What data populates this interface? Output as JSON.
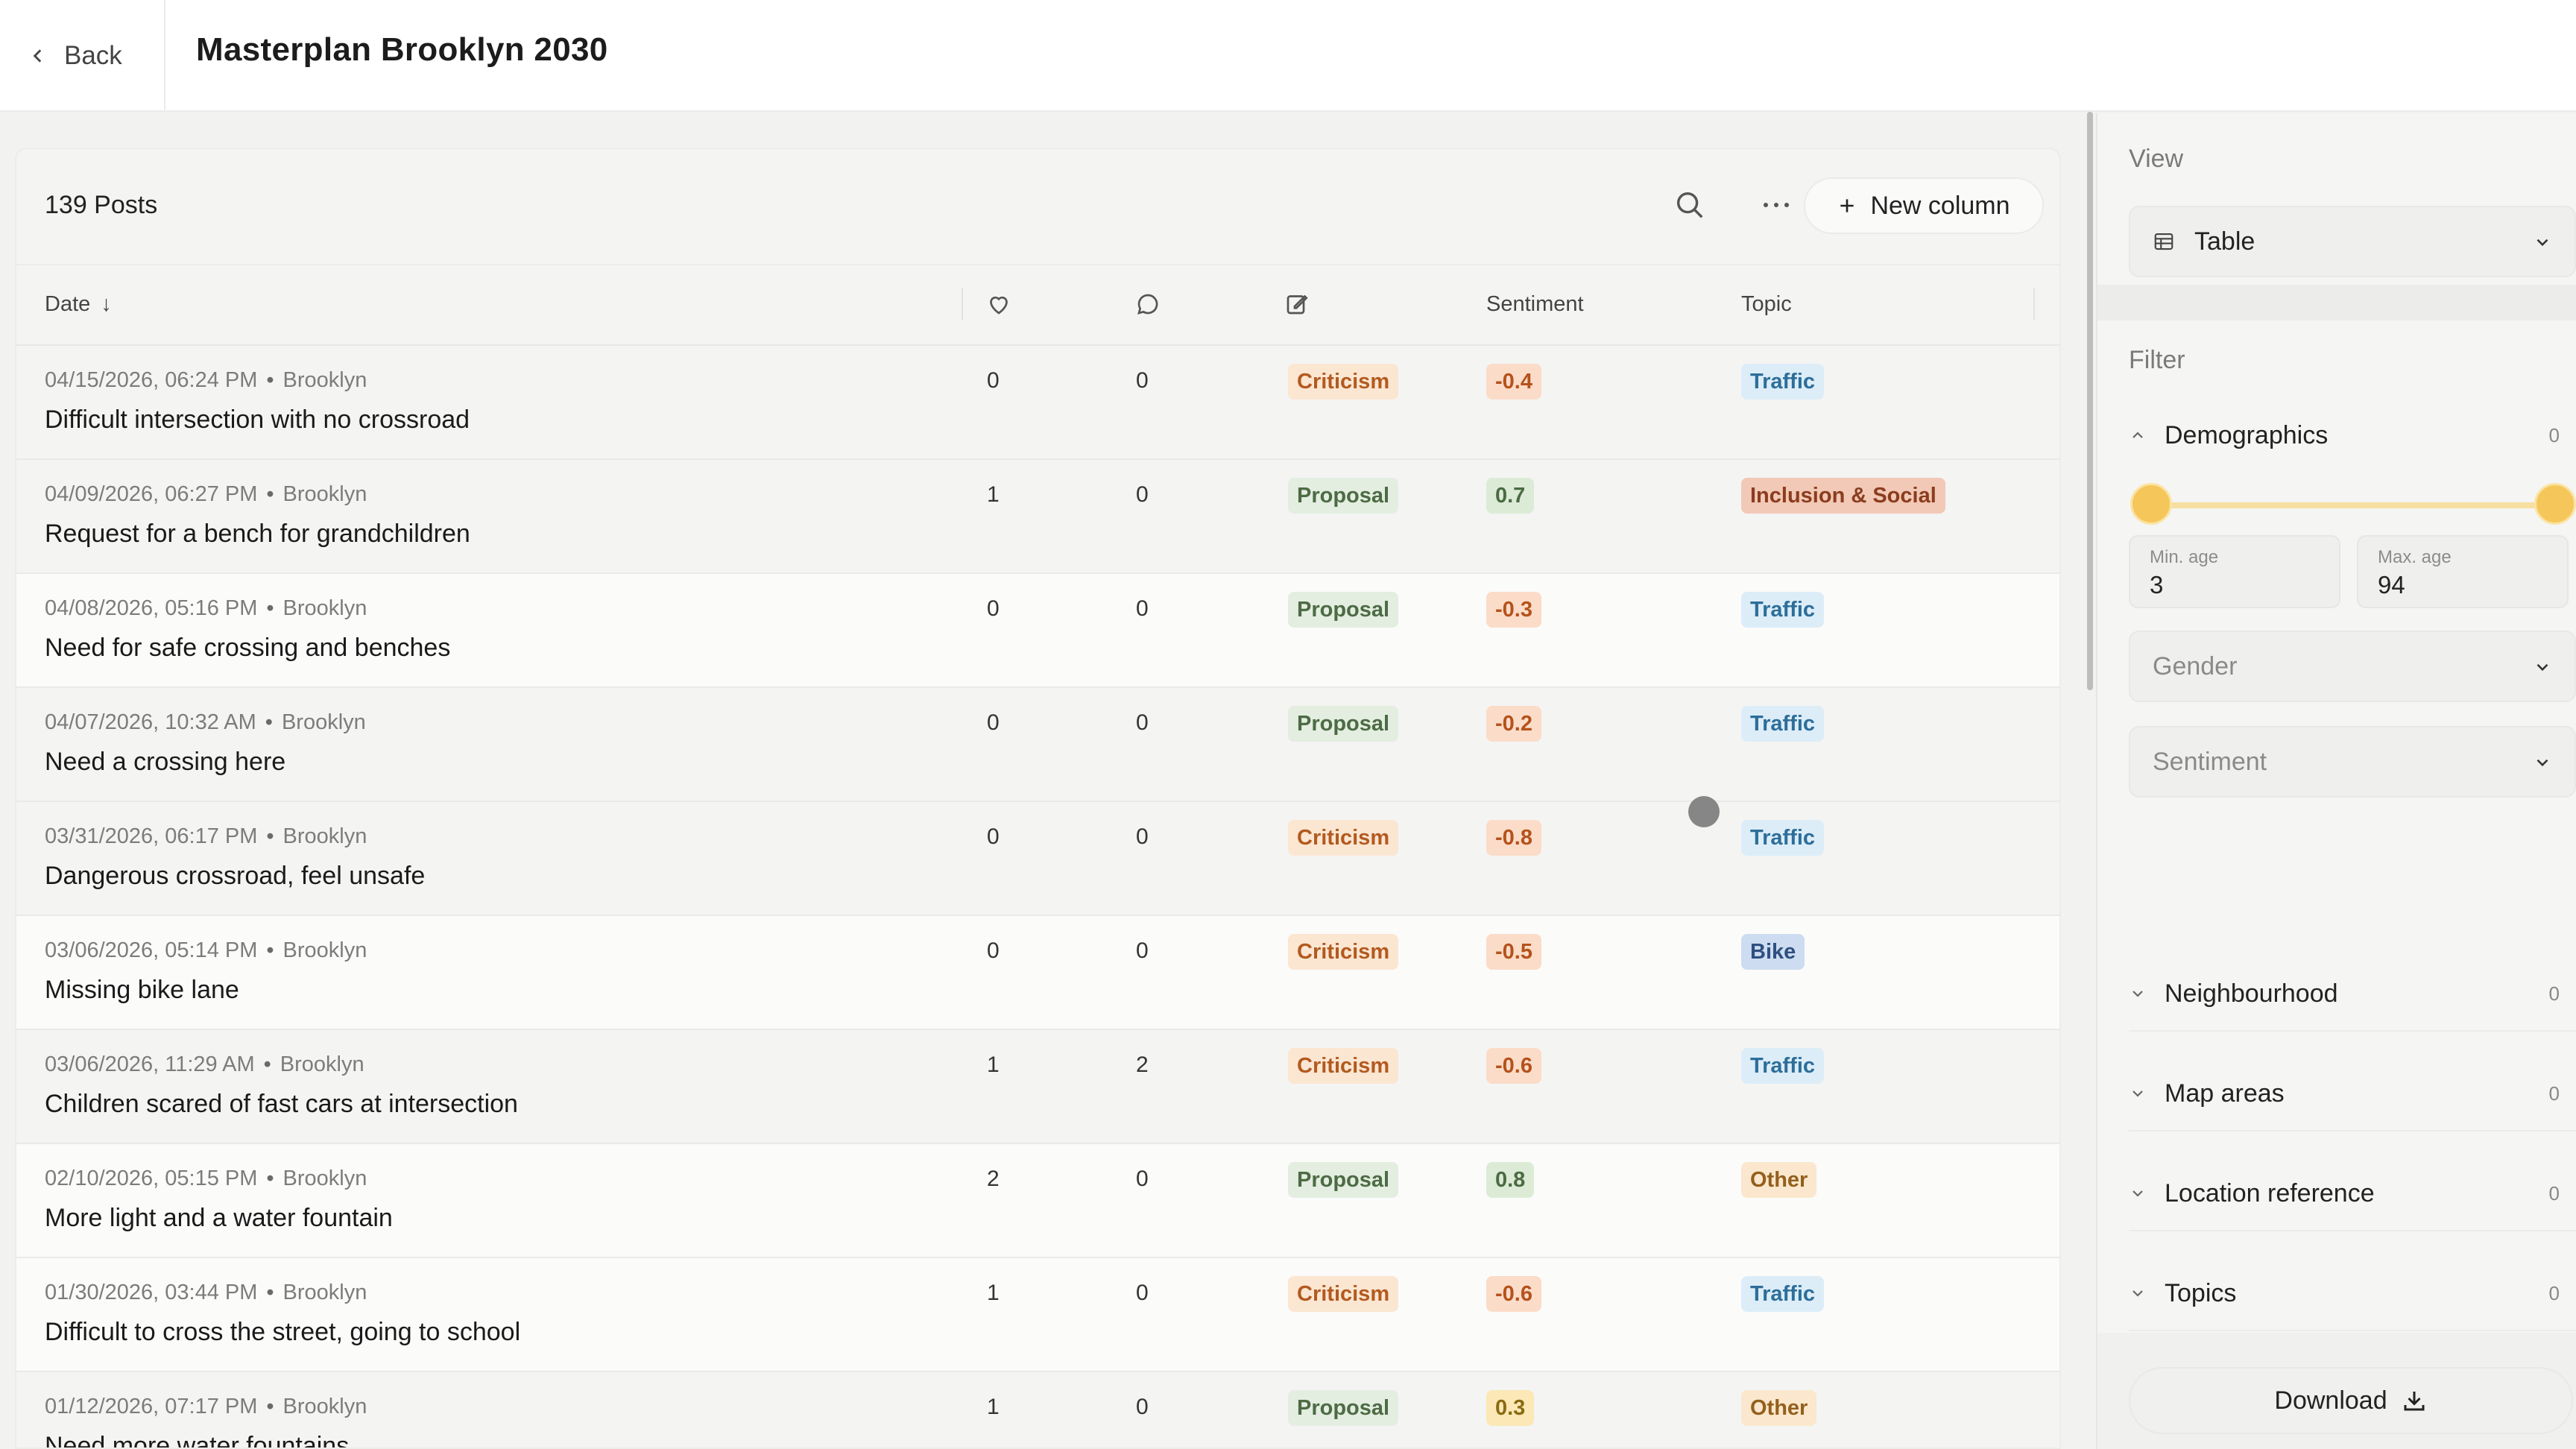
{
  "header": {
    "back_label": "Back",
    "title": "Masterplan Brooklyn 2030"
  },
  "toolbar": {
    "post_count": "139 Posts",
    "new_column_label": "New column"
  },
  "columns": {
    "date": "Date",
    "sentiment": "Sentiment",
    "topic": "Topic"
  },
  "rows": [
    {
      "date": "04/15/2026, 06:24 PM",
      "place": "Brooklyn",
      "title": "Difficult intersection with no crossroad",
      "likes": "0",
      "comments": "0",
      "type": "Criticism",
      "sentiment": "-0.4",
      "topic": "Traffic"
    },
    {
      "date": "04/09/2026, 06:27 PM",
      "place": "Brooklyn",
      "title": "Request for a bench for grandchildren",
      "likes": "1",
      "comments": "0",
      "type": "Proposal",
      "sentiment": "0.7",
      "topic": "Inclusion & Social"
    },
    {
      "date": "04/08/2026, 05:16 PM",
      "place": "Brooklyn",
      "title": "Need for safe crossing and benches",
      "likes": "0",
      "comments": "0",
      "type": "Proposal",
      "sentiment": "-0.3",
      "topic": "Traffic"
    },
    {
      "date": "04/07/2026, 10:32 AM",
      "place": "Brooklyn",
      "title": "Need a crossing here",
      "likes": "0",
      "comments": "0",
      "type": "Proposal",
      "sentiment": "-0.2",
      "topic": "Traffic"
    },
    {
      "date": "03/31/2026, 06:17 PM",
      "place": "Brooklyn",
      "title": "Dangerous crossroad, feel unsafe",
      "likes": "0",
      "comments": "0",
      "type": "Criticism",
      "sentiment": "-0.8",
      "topic": "Traffic"
    },
    {
      "date": "03/06/2026, 05:14 PM",
      "place": "Brooklyn",
      "title": "Missing bike lane",
      "likes": "0",
      "comments": "0",
      "type": "Criticism",
      "sentiment": "-0.5",
      "topic": "Bike"
    },
    {
      "date": "03/06/2026, 11:29 AM",
      "place": "Brooklyn",
      "title": "Children scared of fast cars at intersection",
      "likes": "1",
      "comments": "2",
      "type": "Criticism",
      "sentiment": "-0.6",
      "topic": "Traffic"
    },
    {
      "date": "02/10/2026, 05:15 PM",
      "place": "Brooklyn",
      "title": "More light and a water fountain",
      "likes": "2",
      "comments": "0",
      "type": "Proposal",
      "sentiment": "0.8",
      "topic": "Other"
    },
    {
      "date": "01/30/2026, 03:44 PM",
      "place": "Brooklyn",
      "title": "Difficult to cross the street, going to school",
      "likes": "1",
      "comments": "0",
      "type": "Criticism",
      "sentiment": "-0.6",
      "topic": "Traffic"
    },
    {
      "date": "01/12/2026, 07:17 PM",
      "place": "Brooklyn",
      "title": "Need more water fountains",
      "likes": "1",
      "comments": "0",
      "type": "Proposal",
      "sentiment": "0.3",
      "topic": "Other"
    }
  ],
  "panel": {
    "view_label": "View",
    "view_value": "Table",
    "filter_label": "Filter",
    "demographics": {
      "label": "Demographics",
      "count": "0"
    },
    "age": {
      "min_label": "Min. age",
      "min_value": "3",
      "max_label": "Max. age",
      "max_value": "94",
      "range_min": 3,
      "range_max": 94
    },
    "gender_placeholder": "Gender",
    "sentiment_placeholder": "Sentiment",
    "sections": [
      {
        "label": "Neighbourhood",
        "count": "0"
      },
      {
        "label": "Map areas",
        "count": "0"
      },
      {
        "label": "Location reference",
        "count": "0"
      },
      {
        "label": "Topics",
        "count": "0"
      }
    ],
    "download_label": "Download"
  },
  "colors": {
    "criticism_bg": "#fbe6d2",
    "criticism_fg": "#b35a1f",
    "proposal_bg": "#e3eee0",
    "proposal_fg": "#4d6b45",
    "neg_bg": "#fbdcc8",
    "neg_fg": "#b5521c",
    "pos_bg": "#dcebd6",
    "pos_fg": "#4b6b43",
    "mid_bg": "#fbe8b6",
    "mid_fg": "#8a6a12",
    "traffic_bg": "#dcedf8",
    "traffic_fg": "#2d6e99",
    "inclusion_bg": "#f2c8b6",
    "inclusion_fg": "#8a3d1e",
    "bike_bg": "#cddcf0",
    "bike_fg": "#2f4f80",
    "other_bg": "#fbe7cd",
    "other_fg": "#93601d",
    "slider": "#f5c75a"
  }
}
